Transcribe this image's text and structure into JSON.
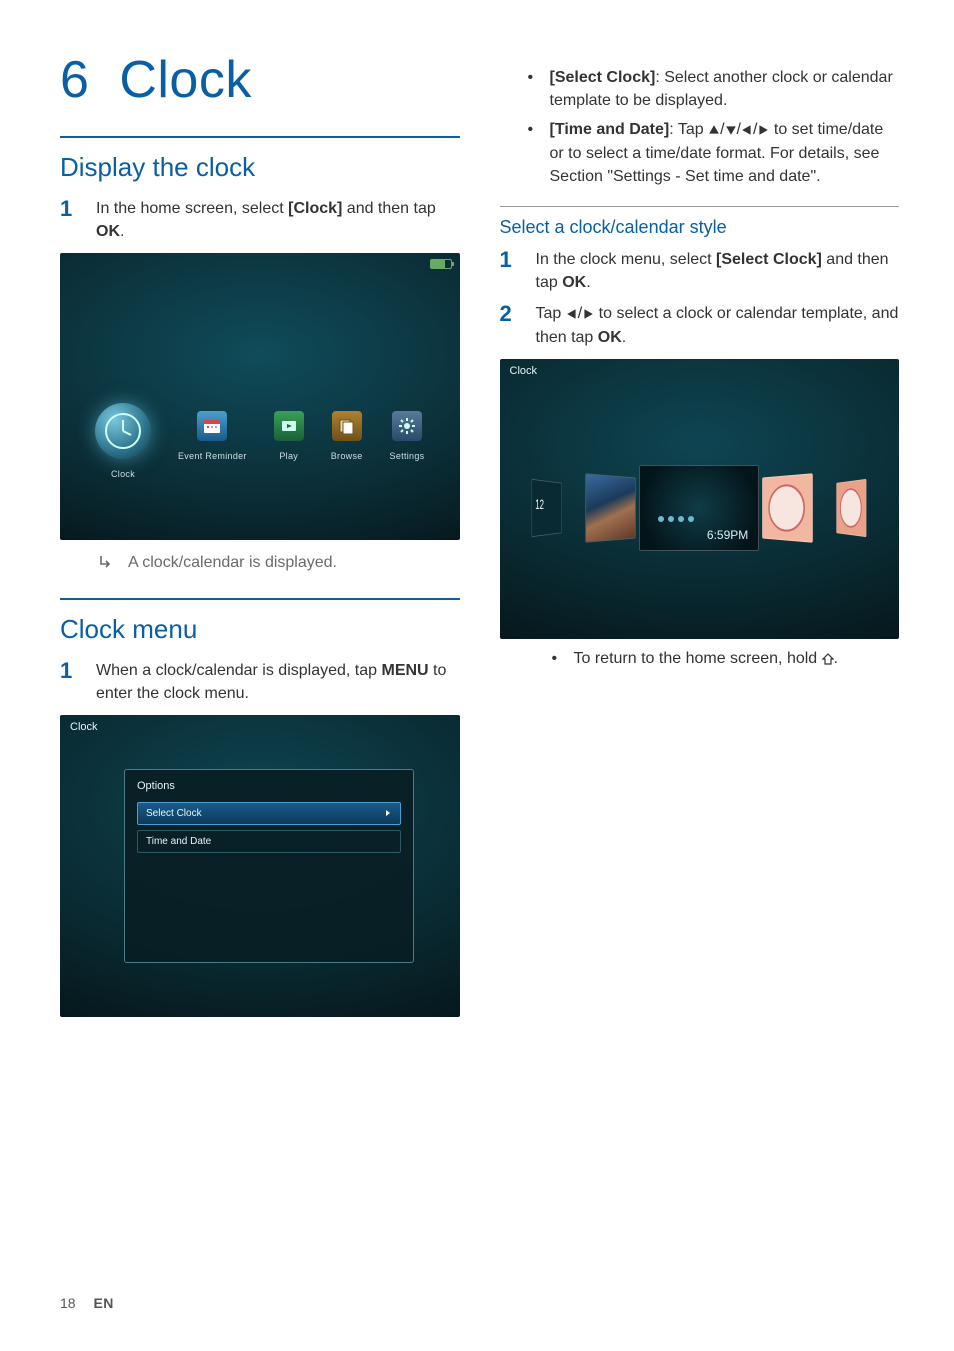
{
  "chapter": {
    "number": "6",
    "title": "Clock"
  },
  "section_display": {
    "heading": "Display the clock",
    "step1_pre": "In the home screen, select ",
    "step1_bold": "[Clock]",
    "step1_mid": " and then tap ",
    "step1_ok": "OK",
    "step1_post": ".",
    "result": "A clock/calendar is displayed."
  },
  "home_shot": {
    "items": [
      "Clock",
      "Event Reminder",
      "Play",
      "Browse",
      "Settings"
    ]
  },
  "section_menu": {
    "heading": "Clock menu",
    "step1_pre": "When a clock/calendar is displayed, tap ",
    "step1_bold": "MENU",
    "step1_post": " to enter the clock menu."
  },
  "popup_shot": {
    "breadcrumb": "Clock",
    "title": "Options",
    "opts": [
      "Select Clock",
      "Time and Date"
    ]
  },
  "right_bullets": {
    "b1_bold": "[Select Clock]",
    "b1_rest": ": Select another clock or calendar template to be displayed.",
    "b2_bold": "[Time and Date]",
    "b2_a": ": Tap ",
    "b2_b": " to set time/date or to select a time/date format. For details, see Section \"Settings - Set time and date\"."
  },
  "sub_style": {
    "heading": "Select a clock/calendar style",
    "s1_pre": "In the clock menu, select ",
    "s1_bold": "[Select Clock]",
    "s1_mid": " and then tap ",
    "s1_ok": "OK",
    "s1_post": ".",
    "s2_pre": "Tap ",
    "s2_mid": " to select a clock or calendar template, and then tap ",
    "s2_ok": "OK",
    "s2_post": "."
  },
  "style_shot": {
    "breadcrumb": "Clock",
    "side2_label": "12",
    "center_time": "6:59PM"
  },
  "return_bullet": {
    "text_a": "To return to the home screen, hold ",
    "text_b": "."
  },
  "footer": {
    "page": "18",
    "lang": "EN"
  }
}
